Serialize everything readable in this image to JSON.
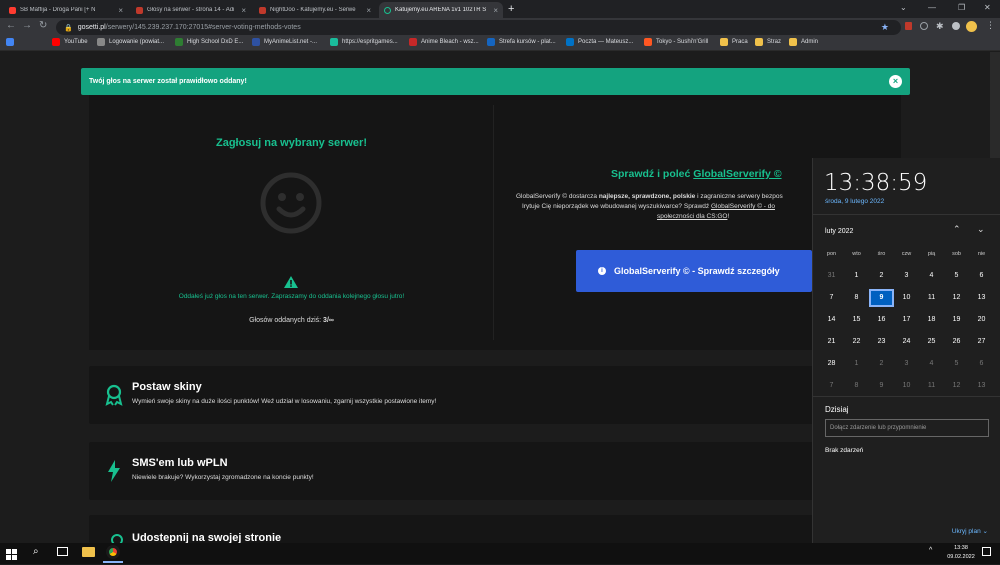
{
  "tabs": [
    {
      "title": "SB Maffija - Droga Pani [+ N"
    },
    {
      "title": "Głosy na serwer - strona 14 - Adi"
    },
    {
      "title": "NightDoo - Katujemy.eu - Serwe"
    },
    {
      "title": "Katujemy.eu ARENA 1v1 102TR S"
    }
  ],
  "omnibox": {
    "host": "gosetti.pl",
    "path": "/serwery/145.239.237.170:27015#server-voting-methods-votes"
  },
  "bookmarks": [
    {
      "label": "Aplikacje",
      "color": "#4285f4"
    },
    {
      "label": "YouTube",
      "color": "#ff0000"
    },
    {
      "label": "Logowanie (powiat...",
      "color": "#888888"
    },
    {
      "label": "High School DxD E...",
      "color": "#2e7d32"
    },
    {
      "label": "MyAnimeList.net -...",
      "color": "#2e51a2"
    },
    {
      "label": "https://espritgames...",
      "color": "#1abc9c"
    },
    {
      "label": "Anime Bleach - wsz...",
      "color": "#c62828"
    },
    {
      "label": "Strefa kursów - plat...",
      "color": "#1565c0"
    },
    {
      "label": "Poczta — Mateusz...",
      "color": "#0072c6"
    },
    {
      "label": "Tokyo - Sushi'n'Grill",
      "color": "#ff5722"
    },
    {
      "label": "Praca",
      "color": "#f0c14b"
    },
    {
      "label": "Straz",
      "color": "#f0c14b"
    },
    {
      "label": "Admin",
      "color": "#f0c14b"
    }
  ],
  "toast": {
    "message": "Twój głos na serwer został prawidłowo oddany!",
    "close": "×"
  },
  "vote": {
    "title": "Zagłosuj na wybrany serwer!",
    "notice": "Oddałeś już głos na ten serwer. Zapraszamy do oddania kolejnego głosu jutro!",
    "votes_label": "Głosów oddanych dziś:",
    "votes_value": "3/∞"
  },
  "serverify": {
    "title_prefix": "Sprawdź i poleć ",
    "title_link": "GlobalServerify ©",
    "p1_a": "GlobalServerify © dostarcza ",
    "p1_b": "najlepsze, sprawdzone, polskie",
    "p1_c": " i zagraniczne serwery bezpos",
    "p2_a": "Irytuje Cię nieporządek we wbudowanej wyszukiwarce? Sprawdź ",
    "p2_b": "GlobalServerify © - do",
    "p3": "społeczności dla CS:GO",
    "p3_end": "!",
    "button": "GlobalServerify © - Sprawdź szczegóły"
  },
  "cards": [
    {
      "title": "Postaw skiny",
      "desc": "Wymień swoje skiny na duże ilości punktów! Weź udział w losowaniu, zgarnij wszystkie postawione itemy!"
    },
    {
      "title": "SMS'em lub wPLN",
      "desc": "Niewiele brakuje? Wykorzystaj zgromadzone na koncie punkty!"
    },
    {
      "title": "Udostepnij na swojej stronie",
      "desc": ""
    }
  ],
  "calendar": {
    "time": "13:38:59",
    "date": "środa, 9 lutego 2022",
    "month": "luty 2022",
    "weekdays": [
      "pon",
      "wto",
      "śro",
      "czw",
      "pią",
      "sob",
      "nie"
    ],
    "weeks": [
      [
        "31",
        "1",
        "2",
        "3",
        "4",
        "5",
        "6"
      ],
      [
        "7",
        "8",
        "9",
        "10",
        "11",
        "12",
        "13"
      ],
      [
        "14",
        "15",
        "16",
        "17",
        "18",
        "19",
        "20"
      ],
      [
        "21",
        "22",
        "23",
        "24",
        "25",
        "26",
        "27"
      ],
      [
        "28",
        "1",
        "2",
        "3",
        "4",
        "5",
        "6"
      ],
      [
        "7",
        "8",
        "9",
        "10",
        "11",
        "12",
        "13"
      ]
    ],
    "today": "9",
    "today_label": "Dzisiaj",
    "event_placeholder": "Dołącz zdarzenie lub przypomnienie",
    "no_events": "Brak zdarzeń",
    "hide_plan": "Ukryj plan"
  },
  "taskbar": {
    "time": "13:38",
    "date": "09.02.2022"
  },
  "colors": {
    "accent_green": "#18c08f",
    "toast": "#14a37f",
    "button_blue": "#2f5cd8",
    "today": "#0060c0"
  }
}
